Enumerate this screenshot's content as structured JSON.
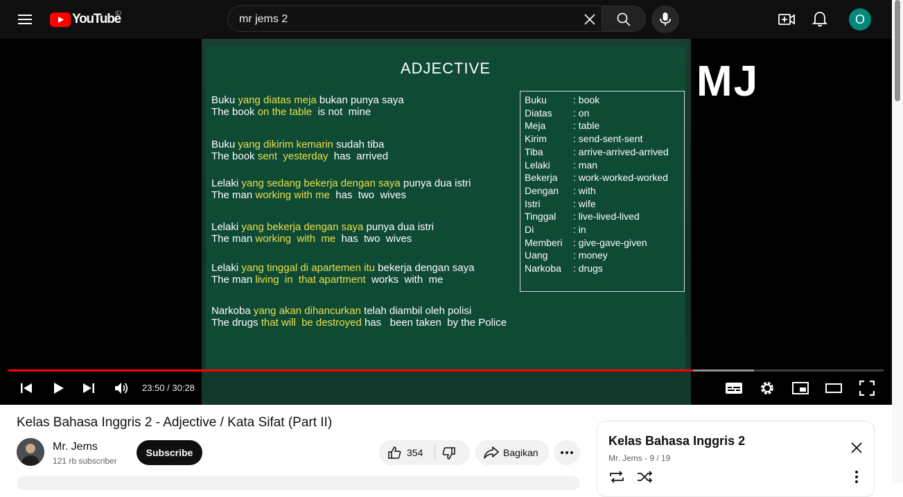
{
  "masthead": {
    "logo_text": "YouTube",
    "country_code": "ID",
    "search_value": "mr jems 2",
    "avatar_letter": "O"
  },
  "slide": {
    "title": "ADJECTIVE",
    "watermark": "MJ",
    "sentences": [
      {
        "l1": [
          "Buku ",
          "yang diatas meja",
          " bukan punya saya"
        ],
        "l2": [
          "The book ",
          "on the table",
          "  is not  mine"
        ]
      },
      {
        "l1": [
          "Buku ",
          "yang dikirim kemarin",
          " sudah tiba"
        ],
        "l2": [
          "The book ",
          "sent  yesterday",
          "  has  arrived"
        ]
      },
      {
        "l1": [
          "Lelaki ",
          "yang sedang bekerja dengan saya",
          " punya dua istri"
        ],
        "l2": [
          "The man ",
          "working with me",
          "  has  two  wives"
        ]
      },
      {
        "l1": [
          "Lelaki ",
          "yang bekerja dengan saya",
          " punya dua istri"
        ],
        "l2": [
          "The man ",
          "working  with  me",
          "  has  two  wives"
        ]
      },
      {
        "l1": [
          "Lelaki ",
          "yang tinggal di apartemen itu",
          " bekerja dengan saya"
        ],
        "l2": [
          "The man ",
          "living  in  that apartment",
          "  works  with  me"
        ]
      },
      {
        "l1": [
          "Narkoba ",
          "yang akan dihancurkan",
          " telah diambil oleh polisi"
        ],
        "l2": [
          "The drugs ",
          "that will  be destroyed",
          " has   been taken  by the Police"
        ]
      }
    ],
    "vocab": [
      {
        "w": "Buku",
        "m": ": book"
      },
      {
        "w": "Diatas",
        "m": ": on"
      },
      {
        "w": "Meja",
        "m": ": table"
      },
      {
        "w": "Kirim",
        "m": ": send-sent-sent"
      },
      {
        "w": "Tiba",
        "m": ": arrive-arrived-arrived"
      },
      {
        "w": "Lelaki",
        "m": ": man"
      },
      {
        "w": "Bekerja",
        "m": ": work-worked-worked"
      },
      {
        "w": "Dengan",
        "m": ": with"
      },
      {
        "w": "Istri",
        "m": ": wife"
      },
      {
        "w": "Tinggal",
        "m": ": live-lived-lived"
      },
      {
        "w": "Di",
        "m": ": in"
      },
      {
        "w": "Memberi",
        "m": ": give-gave-given"
      },
      {
        "w": "Uang",
        "m": ": money"
      },
      {
        "w": "Narkoba",
        "m": ": drugs"
      }
    ]
  },
  "player": {
    "time": "23:50 / 30:28",
    "progress_played": 0.782,
    "progress_buffered": 0.852
  },
  "video": {
    "title": "Kelas Bahasa Inggris 2 - Adjective / Kata Sifat (Part II)",
    "channel_name": "Mr. Jems",
    "subscribers": "121 rb subscriber",
    "subscribe_label": "Subscribe",
    "likes": "354",
    "share_label": "Bagikan"
  },
  "playlist": {
    "title": "Kelas Bahasa Inggris 2",
    "meta": "Mr. Jems - 9 / 19"
  },
  "colors": {
    "accent_red": "#ff0000",
    "chalkboard": "#0f4a35",
    "highlight_yellow": "#e8e04a"
  }
}
